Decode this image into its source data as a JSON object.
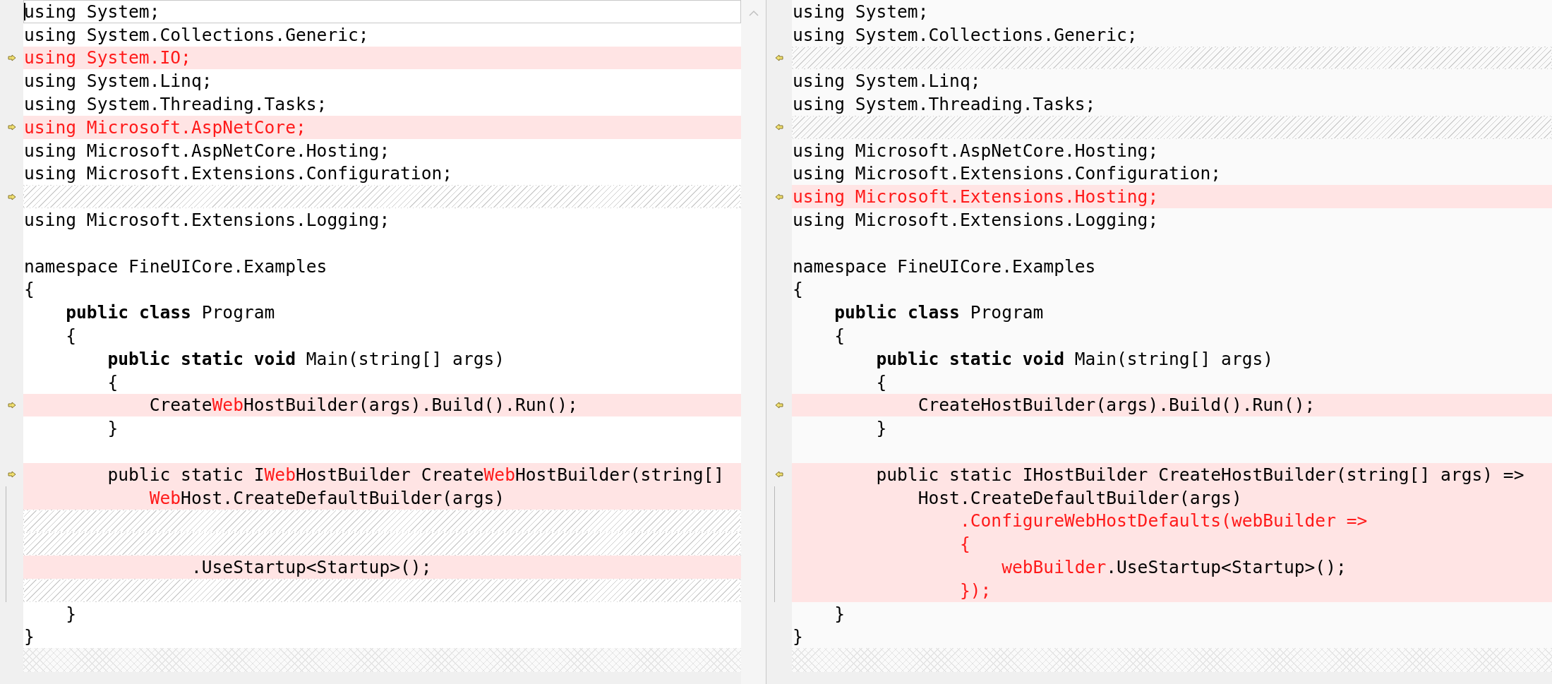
{
  "panes": [
    {
      "kind": "original",
      "lines": [
        {
          "kind": "code",
          "current": true,
          "segments": [
            {
              "text": "using System;",
              "changed": false
            }
          ]
        },
        {
          "kind": "code",
          "segments": [
            {
              "text": "using System.Collections.Generic;",
              "changed": false
            }
          ]
        },
        {
          "kind": "changed",
          "marker": true,
          "segments": [
            {
              "text": "using System.IO;",
              "changed": true
            }
          ]
        },
        {
          "kind": "code",
          "segments": [
            {
              "text": "using System.Linq;",
              "changed": false
            }
          ]
        },
        {
          "kind": "code",
          "segments": [
            {
              "text": "using System.Threading.Tasks;",
              "changed": false
            }
          ]
        },
        {
          "kind": "changed",
          "marker": true,
          "segments": [
            {
              "text": "using Microsoft.AspNetCore;",
              "changed": true
            }
          ]
        },
        {
          "kind": "code",
          "segments": [
            {
              "text": "using Microsoft.AspNetCore.Hosting;",
              "changed": false
            }
          ]
        },
        {
          "kind": "code",
          "segments": [
            {
              "text": "using Microsoft.Extensions.Configuration;",
              "changed": false
            }
          ]
        },
        {
          "kind": "gap",
          "marker": true
        },
        {
          "kind": "code",
          "segments": [
            {
              "text": "using Microsoft.Extensions.Logging;",
              "changed": false
            }
          ]
        },
        {
          "kind": "code"
        },
        {
          "kind": "code",
          "segments": [
            {
              "text": "namespace FineUICore.Examples",
              "changed": false
            }
          ]
        },
        {
          "kind": "code",
          "segments": [
            {
              "text": "{",
              "changed": false
            }
          ]
        },
        {
          "kind": "code",
          "segments": [
            {
              "text": "    **public class** Program",
              "changed": false
            }
          ]
        },
        {
          "kind": "code",
          "segments": [
            {
              "text": "    {",
              "changed": false
            }
          ]
        },
        {
          "kind": "code",
          "segments": [
            {
              "text": "        **public static void** Main(string[] args)",
              "changed": false
            }
          ]
        },
        {
          "kind": "code",
          "segments": [
            {
              "text": "        {",
              "changed": false
            }
          ]
        },
        {
          "kind": "changed",
          "marker": true,
          "segments": [
            {
              "text": "            Create",
              "changed": false
            },
            {
              "text": "Web",
              "changed": true
            },
            {
              "text": "HostBuilder(args).Build().Run();",
              "changed": false
            }
          ]
        },
        {
          "kind": "code",
          "segments": [
            {
              "text": "        }",
              "changed": false
            }
          ]
        },
        {
          "kind": "code"
        },
        {
          "kind": "changed",
          "marker": true,
          "segments": [
            {
              "text": "        public static I",
              "changed": false
            },
            {
              "text": "Web",
              "changed": true
            },
            {
              "text": "HostBuilder Create",
              "changed": false
            },
            {
              "text": "Web",
              "changed": true
            },
            {
              "text": "HostBuilder(string[]",
              "changed": false
            }
          ]
        },
        {
          "kind": "changed",
          "bracket": true,
          "segments": [
            {
              "text": "            Web",
              "changed": true
            },
            {
              "text": "Host.CreateDefaultBuilder(args)",
              "changed": false
            }
          ]
        },
        {
          "kind": "gap",
          "bracket": true
        },
        {
          "kind": "gap",
          "bracket": true
        },
        {
          "kind": "changed",
          "bracket": true,
          "segments": [
            {
              "text": "                .UseStartup<Startup>();",
              "changed": false
            }
          ]
        },
        {
          "kind": "gap",
          "bracket": true
        },
        {
          "kind": "code",
          "segments": [
            {
              "text": "    }",
              "changed": false
            }
          ]
        },
        {
          "kind": "code",
          "segments": [
            {
              "text": "}",
              "changed": false
            }
          ]
        }
      ]
    },
    {
      "kind": "modified",
      "lines": [
        {
          "kind": "code",
          "segments": [
            {
              "text": "using System;",
              "changed": false
            }
          ]
        },
        {
          "kind": "code",
          "segments": [
            {
              "text": "using System.Collections.Generic;",
              "changed": false
            }
          ]
        },
        {
          "kind": "gap",
          "marker": true
        },
        {
          "kind": "code",
          "segments": [
            {
              "text": "using System.Linq;",
              "changed": false
            }
          ]
        },
        {
          "kind": "code",
          "segments": [
            {
              "text": "using System.Threading.Tasks;",
              "changed": false
            }
          ]
        },
        {
          "kind": "gap",
          "marker": true
        },
        {
          "kind": "code",
          "segments": [
            {
              "text": "using Microsoft.AspNetCore.Hosting;",
              "changed": false
            }
          ]
        },
        {
          "kind": "code",
          "segments": [
            {
              "text": "using Microsoft.Extensions.Configuration;",
              "changed": false
            }
          ]
        },
        {
          "kind": "changed",
          "marker": true,
          "segments": [
            {
              "text": "using Microsoft.Extensions.Hosting;",
              "changed": true
            }
          ]
        },
        {
          "kind": "code",
          "segments": [
            {
              "text": "using Microsoft.Extensions.Logging;",
              "changed": false
            }
          ]
        },
        {
          "kind": "code"
        },
        {
          "kind": "code",
          "segments": [
            {
              "text": "namespace FineUICore.Examples",
              "changed": false
            }
          ]
        },
        {
          "kind": "code",
          "segments": [
            {
              "text": "{",
              "changed": false
            }
          ]
        },
        {
          "kind": "code",
          "segments": [
            {
              "text": "    **public class** Program",
              "changed": false
            }
          ]
        },
        {
          "kind": "code",
          "segments": [
            {
              "text": "    {",
              "changed": false
            }
          ]
        },
        {
          "kind": "code",
          "segments": [
            {
              "text": "        **public static void** Main(string[] args)",
              "changed": false
            }
          ]
        },
        {
          "kind": "code",
          "segments": [
            {
              "text": "        {",
              "changed": false
            }
          ]
        },
        {
          "kind": "changed",
          "marker": true,
          "segments": [
            {
              "text": "            CreateHostBuilder(args).Build().Run();",
              "changed": false
            }
          ]
        },
        {
          "kind": "code",
          "segments": [
            {
              "text": "        }",
              "changed": false
            }
          ]
        },
        {
          "kind": "code"
        },
        {
          "kind": "changed",
          "marker": true,
          "segments": [
            {
              "text": "        public static IHostBuilder CreateHostBuilder(string[] args) =>",
              "changed": false
            }
          ]
        },
        {
          "kind": "changed",
          "bracket": true,
          "segments": [
            {
              "text": "            Host.CreateDefaultBuilder(args)",
              "changed": false
            }
          ]
        },
        {
          "kind": "changed",
          "bracket": true,
          "segments": [
            {
              "text": "                .ConfigureWebHostDefaults(webBuilder =>",
              "changed": true
            }
          ]
        },
        {
          "kind": "changed",
          "bracket": true,
          "segments": [
            {
              "text": "                {",
              "changed": true
            }
          ]
        },
        {
          "kind": "changed",
          "bracket": true,
          "segments": [
            {
              "text": "                    webBuilder",
              "changed": true
            },
            {
              "text": ".UseStartup<Startup>();",
              "changed": false
            }
          ]
        },
        {
          "kind": "changed",
          "bracket": true,
          "segments": [
            {
              "text": "                });",
              "changed": true
            }
          ]
        },
        {
          "kind": "code",
          "segments": [
            {
              "text": "    }",
              "changed": false
            }
          ]
        },
        {
          "kind": "code",
          "segments": [
            {
              "text": "}",
              "changed": false
            }
          ]
        }
      ]
    }
  ]
}
